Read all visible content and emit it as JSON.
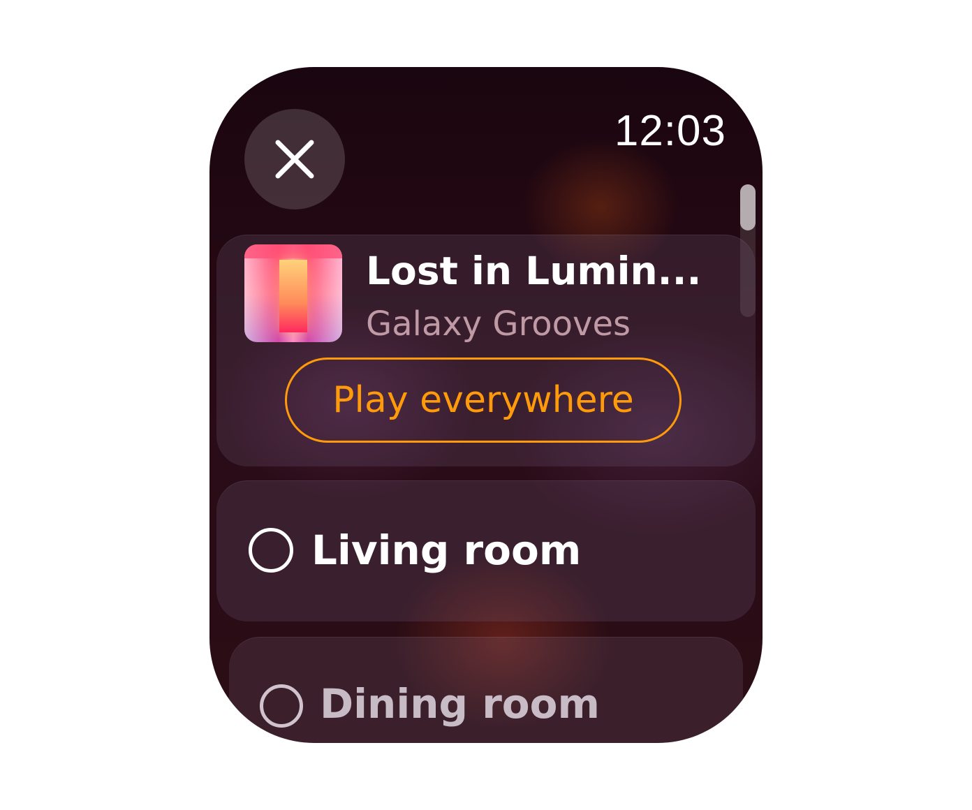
{
  "status": {
    "time": "12:03"
  },
  "now_playing": {
    "title": "Lost in Lumin...",
    "artist": "Galaxy Grooves",
    "play_everywhere_label": "Play everywhere"
  },
  "rooms": [
    {
      "label": "Living room",
      "selected": false
    },
    {
      "label": "Dining room",
      "selected": false
    }
  ],
  "icons": {
    "close": "close-icon",
    "radio": "radio-unchecked-icon"
  },
  "colors": {
    "accent": "#ff9a0a",
    "text": "#ffffff",
    "background": "#240812"
  }
}
